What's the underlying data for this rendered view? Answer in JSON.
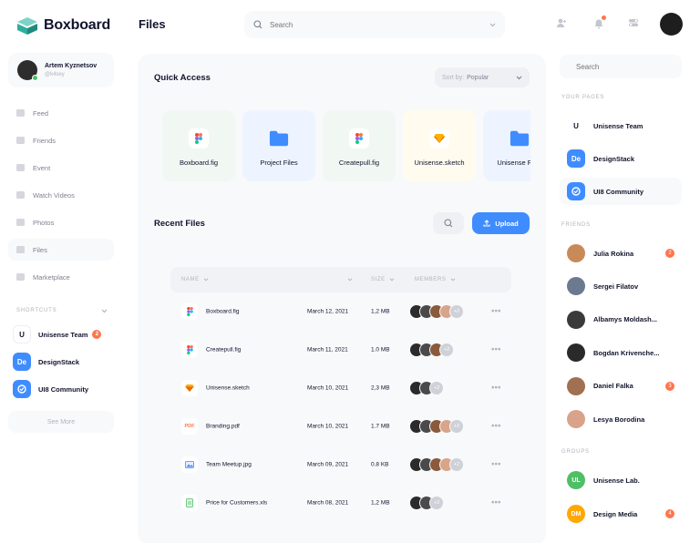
{
  "app": {
    "name": "Boxboard"
  },
  "user": {
    "name": "Artem Kyznetsov",
    "handle": "@k4sey"
  },
  "nav": [
    {
      "label": "Feed",
      "icon": "feed-icon"
    },
    {
      "label": "Friends",
      "icon": "friends-icon"
    },
    {
      "label": "Event",
      "icon": "event-icon"
    },
    {
      "label": "Watch Videos",
      "icon": "video-icon"
    },
    {
      "label": "Photos",
      "icon": "photos-icon"
    },
    {
      "label": "Files",
      "icon": "files-icon",
      "active": true
    },
    {
      "label": "Marketplace",
      "icon": "marketplace-icon"
    }
  ],
  "shortcuts": {
    "heading": "SHORTCUTS",
    "items": [
      {
        "label": "Unisense Team",
        "icon_text": "U",
        "color": "#ffffff",
        "badge": "2"
      },
      {
        "label": "DesignStack",
        "icon_text": "De",
        "color": "#3f8cff"
      },
      {
        "label": "UI8 Community",
        "icon_text": "",
        "color": "#3f8cff"
      }
    ],
    "see_more": "See More"
  },
  "header": {
    "title": "Files",
    "search_placeholder": "Search"
  },
  "quick_access": {
    "title": "Quick Access",
    "sort_label": "Sort by:",
    "sort_value": "Popular",
    "cards": [
      {
        "label": "Boxboard.fig",
        "icon": "figma-icon",
        "bg": "#f1f8f3"
      },
      {
        "label": "Project Files",
        "icon": "folder-icon",
        "bg": "#eef4ff"
      },
      {
        "label": "Createpull.fig",
        "icon": "figma-icon",
        "bg": "#f1f8f3"
      },
      {
        "label": "Unisense.sketch",
        "icon": "sketch-icon",
        "bg": "#fffbee"
      },
      {
        "label": "Unisense Files",
        "icon": "folder-icon",
        "bg": "#eef4ff"
      }
    ]
  },
  "recent_files": {
    "title": "Recent Files",
    "upload_label": "Upload",
    "columns": {
      "name": "NAME",
      "size": "SIZE",
      "members": "MEMBERS"
    },
    "rows": [
      {
        "name": "Boxboard.fig",
        "date": "March 12, 2021",
        "size": "1,2 MB",
        "icon": "figma-icon",
        "members": 4,
        "extra": "+2"
      },
      {
        "name": "Createpull.fig",
        "date": "March 11, 2021",
        "size": "1.0 MB",
        "icon": "figma-icon",
        "members": 3,
        "extra": "+2"
      },
      {
        "name": "Unisense.sketch",
        "date": "March 10, 2021",
        "size": "2,3 MB",
        "icon": "sketch-icon",
        "members": 2,
        "extra": "+2"
      },
      {
        "name": "Branding.pdf",
        "date": "March 10, 2021",
        "size": "1.7 MB",
        "icon": "pdf-icon",
        "members": 4,
        "extra": "+2"
      },
      {
        "name": "Team Meetup.jpg",
        "date": "March 09, 2021",
        "size": "0.8 KB",
        "icon": "image-icon",
        "members": 4,
        "extra": "+2"
      },
      {
        "name": "Price for Customers.xls",
        "date": "March 08, 2021",
        "size": "1,2 MB",
        "icon": "sheet-icon",
        "members": 2,
        "extra": "+2"
      }
    ]
  },
  "right_sidebar": {
    "search_placeholder": "Search",
    "pages_heading": "YOUR PAGES",
    "pages": [
      {
        "label": "Unisense Team",
        "icon_text": "U",
        "color": "#ffffff"
      },
      {
        "label": "DesignStack",
        "icon_text": "De",
        "color": "#3f8cff"
      },
      {
        "label": "UI8 Community",
        "icon_text": "",
        "color": "#3f8cff"
      }
    ],
    "friends_heading": "FRIENDS",
    "friends": [
      {
        "name": "Julia Rokina",
        "color": "#c98a5a",
        "badge": "2"
      },
      {
        "name": "Sergei Filatov",
        "color": "#6b7a8f"
      },
      {
        "name": "Albamys Moldash...",
        "color": "#3a3a3a"
      },
      {
        "name": "Bogdan Krivenche...",
        "color": "#2a2a2a"
      },
      {
        "name": "Daniel Falka",
        "color": "#a07050",
        "badge": "3"
      },
      {
        "name": "Lesya Borodina",
        "color": "#d9a28a"
      }
    ],
    "groups_heading": "GROUPS",
    "groups": [
      {
        "name": "Unisense Lab.",
        "abbr": "UL",
        "color": "#4fbf67"
      },
      {
        "name": "Design Media",
        "abbr": "DM",
        "color": "#ffa800",
        "badge": "4"
      }
    ]
  },
  "colors": {
    "accent": "#3f8cff",
    "badge": "#ff754c",
    "online": "#4fbf67"
  }
}
